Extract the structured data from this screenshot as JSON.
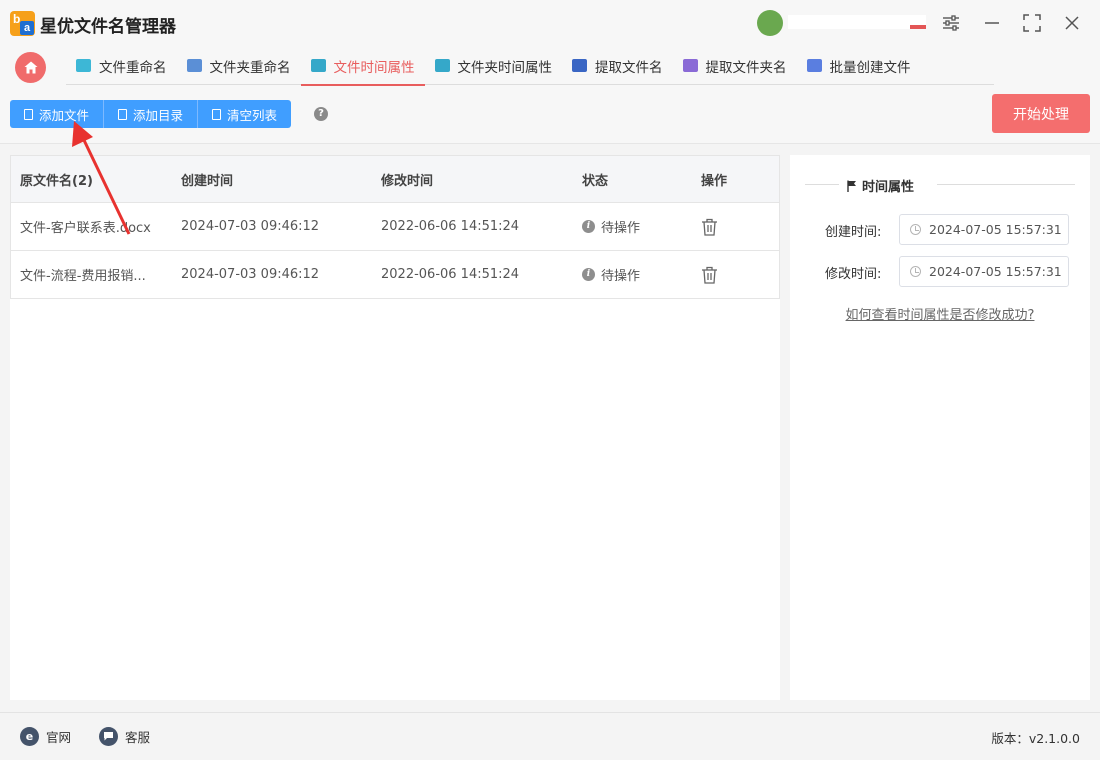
{
  "app": {
    "title": "星优文件名管理器",
    "logo_letters": [
      "b",
      "a"
    ]
  },
  "window_controls": [
    "settings-icon",
    "minimize-icon",
    "maximize-icon",
    "close-icon"
  ],
  "tabs": [
    {
      "label": "文件重命名",
      "icon": "rename-icon",
      "color": "#3db7d6"
    },
    {
      "label": "文件夹重命名",
      "icon": "folder-rename-icon",
      "color": "#5b8fd6"
    },
    {
      "label": "文件时间属性",
      "icon": "file-time-icon",
      "color": "#35a8c9",
      "active": true
    },
    {
      "label": "文件夹时间属性",
      "icon": "folder-time-icon",
      "color": "#35a8c9"
    },
    {
      "label": "提取文件名",
      "icon": "extract-file-icon",
      "color": "#3a66c4"
    },
    {
      "label": "提取文件夹名",
      "icon": "extract-folder-icon",
      "color": "#8a6ad6"
    },
    {
      "label": "批量创建文件",
      "icon": "batch-create-icon",
      "color": "#5a7ee0"
    }
  ],
  "toolbar": {
    "add_file": "添加文件",
    "add_dir": "添加目录",
    "clear_list": "清空列表",
    "help": "?",
    "start": "开始处理"
  },
  "table": {
    "headers": {
      "name": "原文件名(2)",
      "created": "创建时间",
      "modified": "修改时间",
      "status": "状态",
      "action": "操作"
    },
    "rows": [
      {
        "name": "文件-客户联系表.docx",
        "created": "2024-07-03 09:46:12",
        "modified": "2022-06-06 14:51:24",
        "status": "待操作"
      },
      {
        "name": "文件-流程-费用报销...",
        "created": "2024-07-03 09:46:12",
        "modified": "2022-06-06 14:51:24",
        "status": "待操作"
      }
    ]
  },
  "side": {
    "section_title": "时间属性",
    "created_label": "创建时间:",
    "created_value": "2024-07-05 15:57:31",
    "modified_label": "修改时间:",
    "modified_value": "2024-07-05 15:57:31",
    "help_link": "如何查看时间属性是否修改成功?"
  },
  "footer": {
    "website": "官网",
    "website_icon": "e",
    "service": "客服",
    "version": "版本：v2.1.0.0"
  },
  "colors": {
    "primary": "#409eff",
    "accent": "#e85d5d",
    "start": "#f46e6e"
  }
}
